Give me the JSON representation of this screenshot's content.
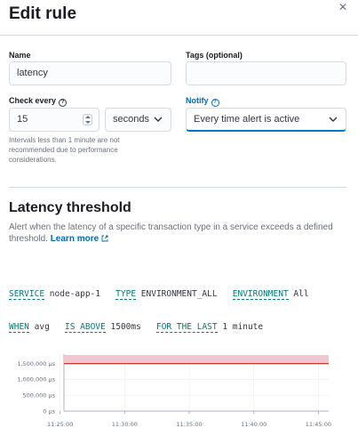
{
  "header": {
    "title": "Edit rule",
    "close_icon": "close-icon"
  },
  "form": {
    "name_label": "Name",
    "name_value": "latency",
    "tags_label": "Tags (optional)",
    "tags_value": "",
    "check_every_label": "Check every",
    "check_every_value": "15",
    "check_every_unit": "seconds",
    "notify_label": "Notify",
    "notify_value": "Every time alert is active",
    "interval_hint": "Intervals less than 1 minute are not recommended due to performance considerations."
  },
  "section": {
    "title": "Latency threshold",
    "description": "Alert when the latency of a specific transaction type in a service exceeds a defined threshold.",
    "learn_more": "Learn more"
  },
  "expression": {
    "service_kw": "SERVICE",
    "service_val": "node-app-1",
    "type_kw": "TYPE",
    "type_val": "ENVIRONMENT_ALL",
    "env_kw": "ENVIRONMENT",
    "env_val": "All",
    "when_kw": "WHEN",
    "when_val": "avg",
    "above_kw": "IS ABOVE",
    "above_val": "1500ms",
    "last_kw": "FOR THE LAST",
    "last_val": "1 minute"
  },
  "chart_data": {
    "type": "area",
    "y_ticks": [
      "0 µs",
      "500,000 µs",
      "1,000,000 µs",
      "1,500,000 µs"
    ],
    "y_tick_values": [
      0,
      500000,
      1000000,
      1500000
    ],
    "ylim": [
      0,
      1800000
    ],
    "x_ticks": [
      "11:25:00",
      "11:30:00",
      "11:35:00",
      "11:40:00",
      "11:45:00"
    ],
    "x_tick_minutes": [
      25,
      30,
      35,
      40,
      45
    ],
    "xlim_minutes": [
      25.3,
      45.8
    ],
    "threshold": 1500000,
    "shaded_above_threshold": true,
    "colors": {
      "threshold": "#bd271e",
      "shade": "#f1c6d0",
      "grid": "#eef0f3"
    }
  }
}
